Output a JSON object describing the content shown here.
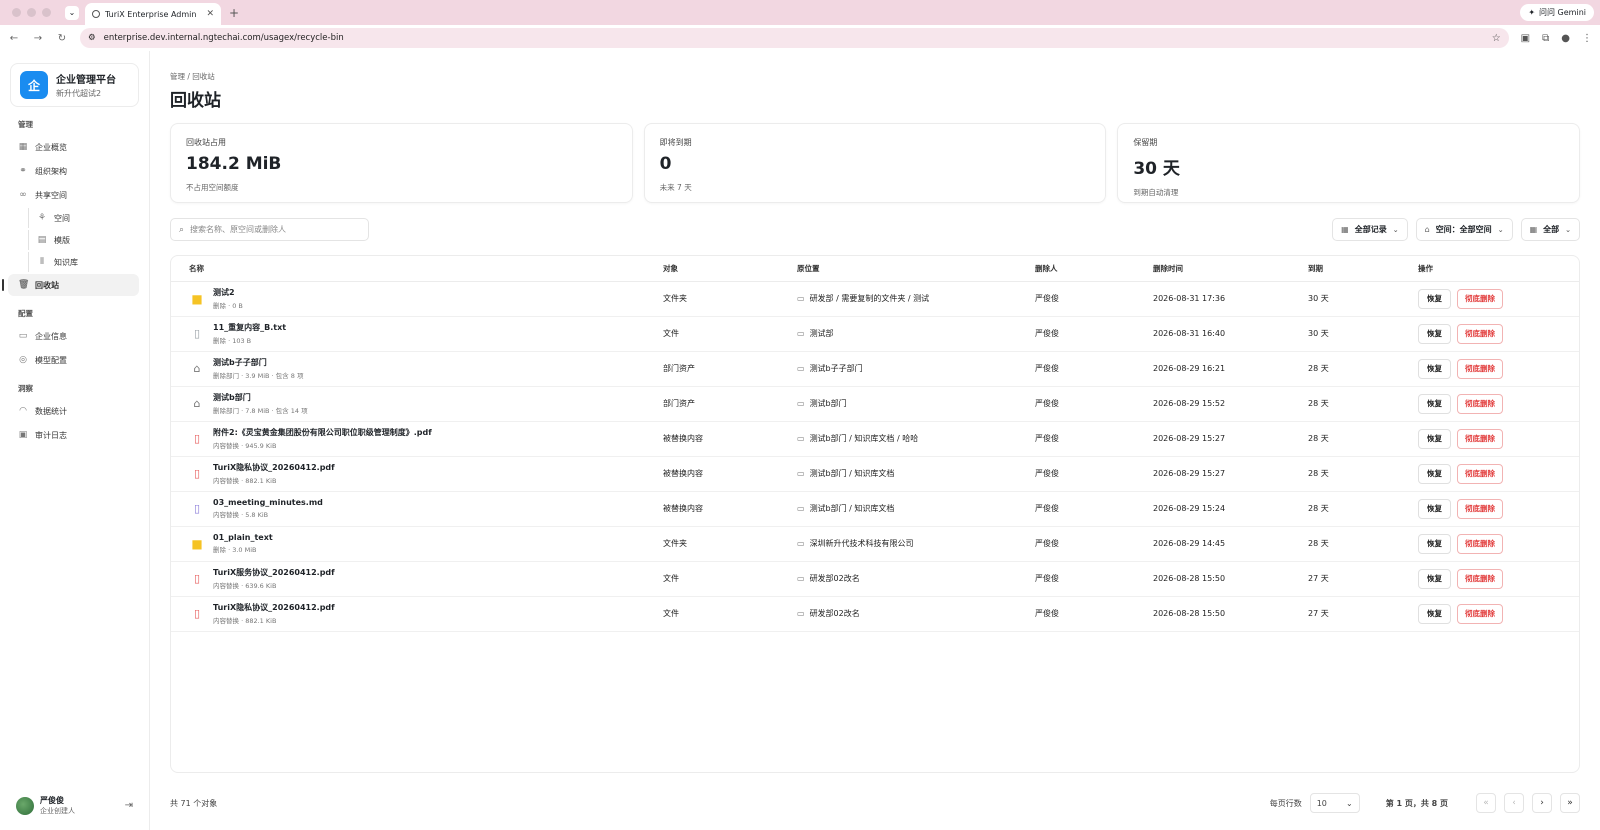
{
  "browser": {
    "tab_title": "TuriX Enterprise Admin",
    "url": "enterprise.dev.internal.ngtechai.com/usagex/recycle-bin",
    "gemini_label": "问问 Gemini"
  },
  "sidebar": {
    "brand_name": "企业管理平台",
    "brand_sub": "新升代超试2",
    "brand_logo": "企",
    "sections": [
      {
        "title": "管理"
      },
      {
        "title": "配置"
      },
      {
        "title": "洞察"
      }
    ],
    "items": [
      {
        "label": "企业概览",
        "icon": "grid-icon"
      },
      {
        "label": "组织架构",
        "icon": "org-icon"
      },
      {
        "label": "共享空间",
        "icon": "share-icon"
      },
      {
        "label": "空间",
        "icon": "space-icon"
      },
      {
        "label": "模版",
        "icon": "template-icon"
      },
      {
        "label": "知识库",
        "icon": "library-icon"
      },
      {
        "label": "回收站",
        "icon": "trash-icon"
      },
      {
        "label": "企业信息",
        "icon": "info-icon"
      },
      {
        "label": "模型配置",
        "icon": "model-icon"
      },
      {
        "label": "数据统计",
        "icon": "stats-icon"
      },
      {
        "label": "审计日志",
        "icon": "log-icon"
      }
    ],
    "user": {
      "name": "严俊俊",
      "role": "企业创建人"
    }
  },
  "main": {
    "breadcrumb": "管理 / 回收站",
    "title": "回收站",
    "stats": [
      {
        "label": "回收站占用",
        "value": "184.2 MiB",
        "sub": "不占用空间额度"
      },
      {
        "label": "即将到期",
        "value": "0",
        "sub": "未来 7 天"
      },
      {
        "label": "保留期",
        "value": "30 天",
        "sub": "到期自动清理"
      }
    ],
    "search_placeholder": "搜索名称、原空间或删除人",
    "filters": {
      "records": "全部记录",
      "space": "空间：全部空间",
      "type": "全部"
    },
    "columns": [
      "名称",
      "对象",
      "原位置",
      "删除人",
      "删除时间",
      "到期",
      "操作"
    ],
    "restore_label": "恢复",
    "delete_label": "彻底删除",
    "rows": [
      {
        "icon": "folder",
        "name": "测试2",
        "sub": "删除 · 0 B",
        "type": "文件夹",
        "loc": "研发部 / 需要复制的文件夹 / 测试",
        "by": "严俊俊",
        "time": "2026-08-31 17:36",
        "exp": "30 天"
      },
      {
        "icon": "file",
        "name": "11_重复内容_B.txt",
        "sub": "删除 · 103 B",
        "type": "文件",
        "loc": "测试部",
        "by": "严俊俊",
        "time": "2026-08-31 16:40",
        "exp": "30 天"
      },
      {
        "icon": "dept",
        "name": "测试b子子部门",
        "sub": "删除部门 · 3.9 MiB · 包含 8 项",
        "type": "部门资产",
        "loc": "测试b子子部门",
        "by": "严俊俊",
        "time": "2026-08-29 16:21",
        "exp": "28 天"
      },
      {
        "icon": "dept",
        "name": "测试b部门",
        "sub": "删除部门 · 7.8 MiB · 包含 14 项",
        "type": "部门资产",
        "loc": "测试b部门",
        "by": "严俊俊",
        "time": "2026-08-29 15:52",
        "exp": "28 天"
      },
      {
        "icon": "pdf",
        "name": "附件2:《灵宝黄金集团股份有限公司职位职级管理制度》.pdf",
        "sub": "内容替换 · 945.9 KiB",
        "type": "被替换内容",
        "loc": "测试b部门 / 知识库文档 / 哈哈",
        "by": "严俊俊",
        "time": "2026-08-29 15:27",
        "exp": "28 天"
      },
      {
        "icon": "pdf",
        "name": "TuriX隐私协议_20260412.pdf",
        "sub": "内容替换 · 882.1 KiB",
        "type": "被替换内容",
        "loc": "测试b部门 / 知识库文档",
        "by": "严俊俊",
        "time": "2026-08-29 15:27",
        "exp": "28 天"
      },
      {
        "icon": "md",
        "name": "03_meeting_minutes.md",
        "sub": "内容替换 · 5.8 KiB",
        "type": "被替换内容",
        "loc": "测试b部门 / 知识库文档",
        "by": "严俊俊",
        "time": "2026-08-29 15:24",
        "exp": "28 天"
      },
      {
        "icon": "folder",
        "name": "01_plain_text",
        "sub": "删除 · 3.0 MiB",
        "type": "文件夹",
        "loc": "深圳新升代技术科技有限公司",
        "by": "严俊俊",
        "time": "2026-08-29 14:45",
        "exp": "28 天"
      },
      {
        "icon": "pdf",
        "name": "TuriX服务协议_20260412.pdf",
        "sub": "内容替换 · 639.6 KiB",
        "type": "文件",
        "loc": "研发部02改名",
        "by": "严俊俊",
        "time": "2026-08-28 15:50",
        "exp": "27 天"
      },
      {
        "icon": "pdf",
        "name": "TuriX隐私协议_20260412.pdf",
        "sub": "内容替换 · 882.1 KiB",
        "type": "文件",
        "loc": "研发部02改名",
        "by": "严俊俊",
        "time": "2026-08-28 15:50",
        "exp": "27 天"
      }
    ],
    "footer": {
      "total": "共 71 个对象",
      "per_page_label": "每页行数",
      "per_page": "10",
      "page_info": "第 1 页，共 8 页"
    }
  }
}
